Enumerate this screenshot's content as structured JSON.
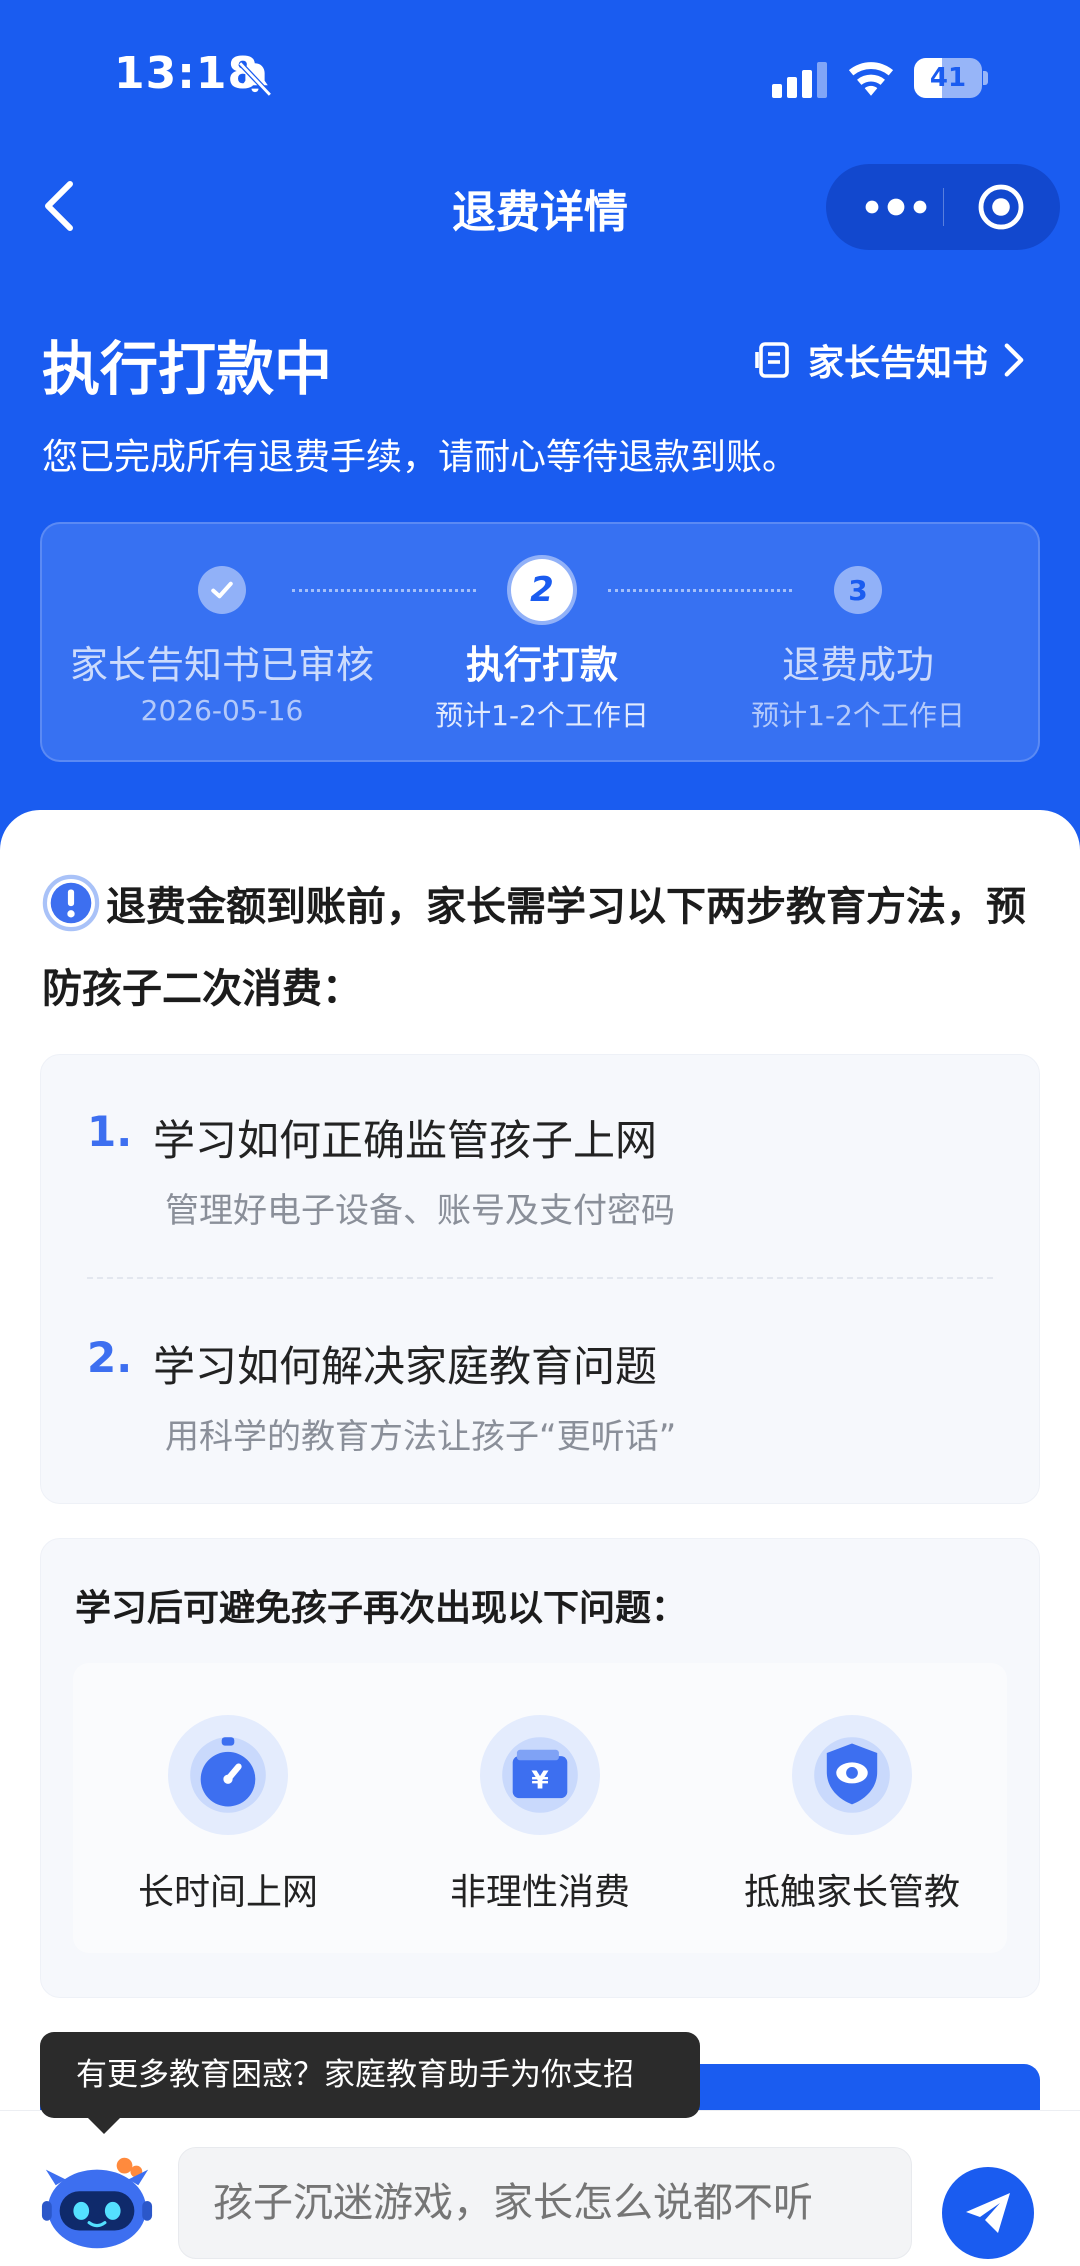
{
  "status_bar": {
    "time": "13:18",
    "battery": "41",
    "battery_level": 0.41
  },
  "nav": {
    "title": "退费详情"
  },
  "header": {
    "status": "执行打款中",
    "notice_link": "家长告知书",
    "description": "您已完成所有退费手续，请耐心等待退款到账。"
  },
  "steps": [
    {
      "marker": "✓",
      "label": "家长告知书已审核",
      "sub": "2026-05-16"
    },
    {
      "marker": "2",
      "label": "执行打款",
      "sub": "预计1-2个工作日"
    },
    {
      "marker": "3",
      "label": "退费成功",
      "sub": "预计1-2个工作日"
    }
  ],
  "warning": {
    "text": "退费金额到账前，家长需学习以下两步教育方法，预防孩子二次消费："
  },
  "learn": [
    {
      "num": "1.",
      "title": "学习如何正确监管孩子上网",
      "sub": "管理好电子设备、账号及支付密码"
    },
    {
      "num": "2.",
      "title": "学习如何解决家庭教育问题",
      "sub": "用科学的教育方法让孩子“更听话”"
    }
  ],
  "problems": {
    "title": "学习后可避免孩子再次出现以下问题：",
    "items": [
      {
        "label": "长时间上网",
        "icon": "stopwatch-icon"
      },
      {
        "label": "非理性消费",
        "icon": "wallet-yen-icon"
      },
      {
        "label": "抵触家长管教",
        "icon": "shield-eye-icon"
      }
    ]
  },
  "tooltip": {
    "text": "有更多教育困惑？家庭教育助手为你支招"
  },
  "chat": {
    "placeholder": "孩子沉迷游戏，家长怎么说都不听"
  },
  "colors": {
    "brand": "#1a5cf0",
    "accent": "#3d6ff0"
  }
}
